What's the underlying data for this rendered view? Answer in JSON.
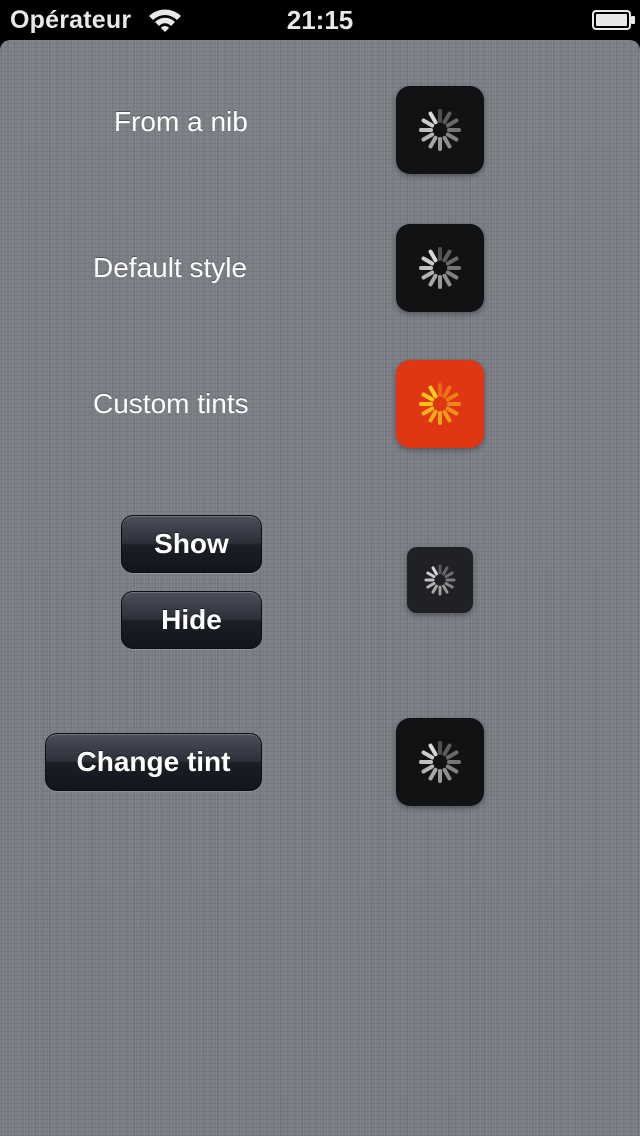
{
  "status_bar": {
    "carrier": "Opérateur",
    "time": "21:15",
    "wifi_icon": "wifi-icon",
    "battery_icon": "battery-full-icon"
  },
  "rows": {
    "nib": {
      "label": "From a nib",
      "hud_color": "#111213",
      "spinner_color": "#d8d8d8"
    },
    "default": {
      "label": "Default style",
      "hud_color": "#111213",
      "spinner_color": "#d8d8d8"
    },
    "custom": {
      "label": "Custom tints",
      "hud_color": "#df3714",
      "spinner_color": "#ffd21a"
    },
    "toggle": {
      "show_label": "Show",
      "hide_label": "Hide",
      "hud_color": "#202124",
      "spinner_color": "#d8d8d8"
    },
    "tint": {
      "button_label": "Change tint",
      "hud_color": "#111213",
      "spinner_color": "#d8d8d8"
    }
  },
  "icons": {
    "spinner": "activity-spinner-icon"
  }
}
